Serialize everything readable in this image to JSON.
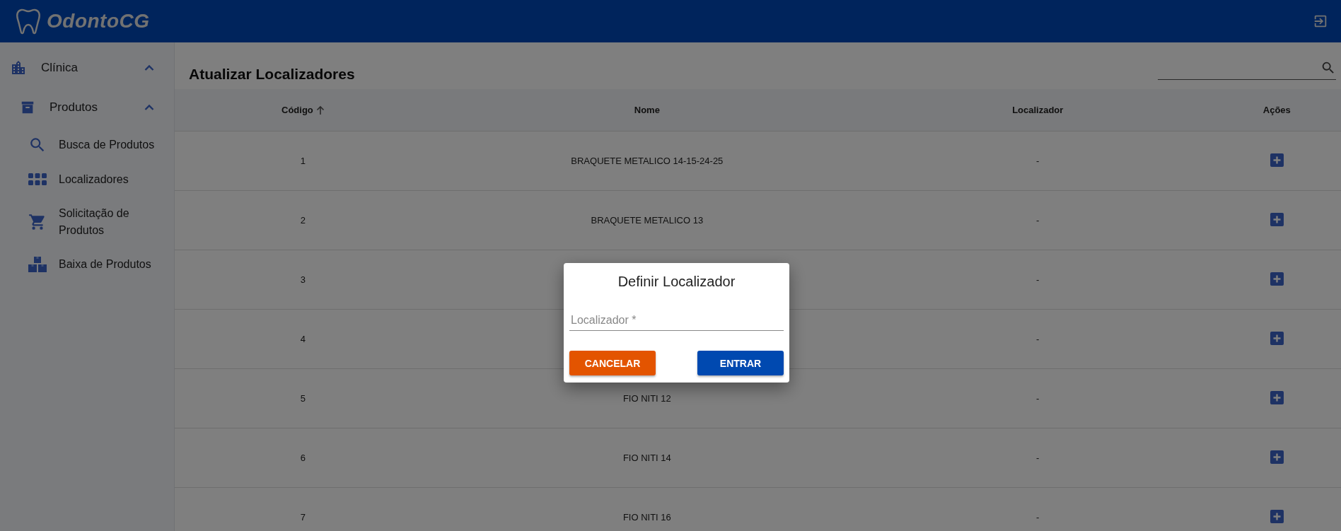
{
  "header": {
    "brand": "OdontoCG"
  },
  "sidebar": {
    "items": [
      {
        "label": "Clínica",
        "expanded": true,
        "children": [
          {
            "label": "Produtos",
            "expanded": true,
            "children": [
              {
                "label": "Busca de Produtos",
                "kind": "search"
              },
              {
                "label": "Localizadores",
                "kind": "grid"
              },
              {
                "label": "Solicitação de Produtos",
                "kind": "cart"
              },
              {
                "label": "Baixa de Produtos",
                "kind": "boxes"
              }
            ]
          }
        ]
      }
    ]
  },
  "page": {
    "title": "Atualizar Localizadores"
  },
  "table": {
    "columns": [
      {
        "label": "Código",
        "sorted": true
      },
      {
        "label": "Nome",
        "sorted": false
      },
      {
        "label": "Localizador",
        "sorted": false
      },
      {
        "label": "Ações",
        "sorted": false
      }
    ],
    "rows": [
      {
        "code": "1",
        "name": "BRAQUETE METALICO 14-15-24-25",
        "locator": "-"
      },
      {
        "code": "2",
        "name": "BRAQUETE METALICO 13",
        "locator": "-"
      },
      {
        "code": "3",
        "locator": "-"
      },
      {
        "code": "4",
        "locator": "-"
      },
      {
        "code": "5",
        "name": "FIO NITI 12",
        "locator": "-"
      },
      {
        "code": "6",
        "name": "FIO NITI 14",
        "locator": "-"
      },
      {
        "code": "7",
        "name": "FIO NITI 16",
        "locator": "-"
      }
    ]
  },
  "dialog": {
    "title": "Definir Localizador",
    "field": {
      "placeholder": "Localizador *"
    },
    "buttons": [
      {
        "label": "CANCELAR",
        "kind": "cancel"
      },
      {
        "label": "ENTRAR",
        "kind": "confirm"
      }
    ]
  }
}
